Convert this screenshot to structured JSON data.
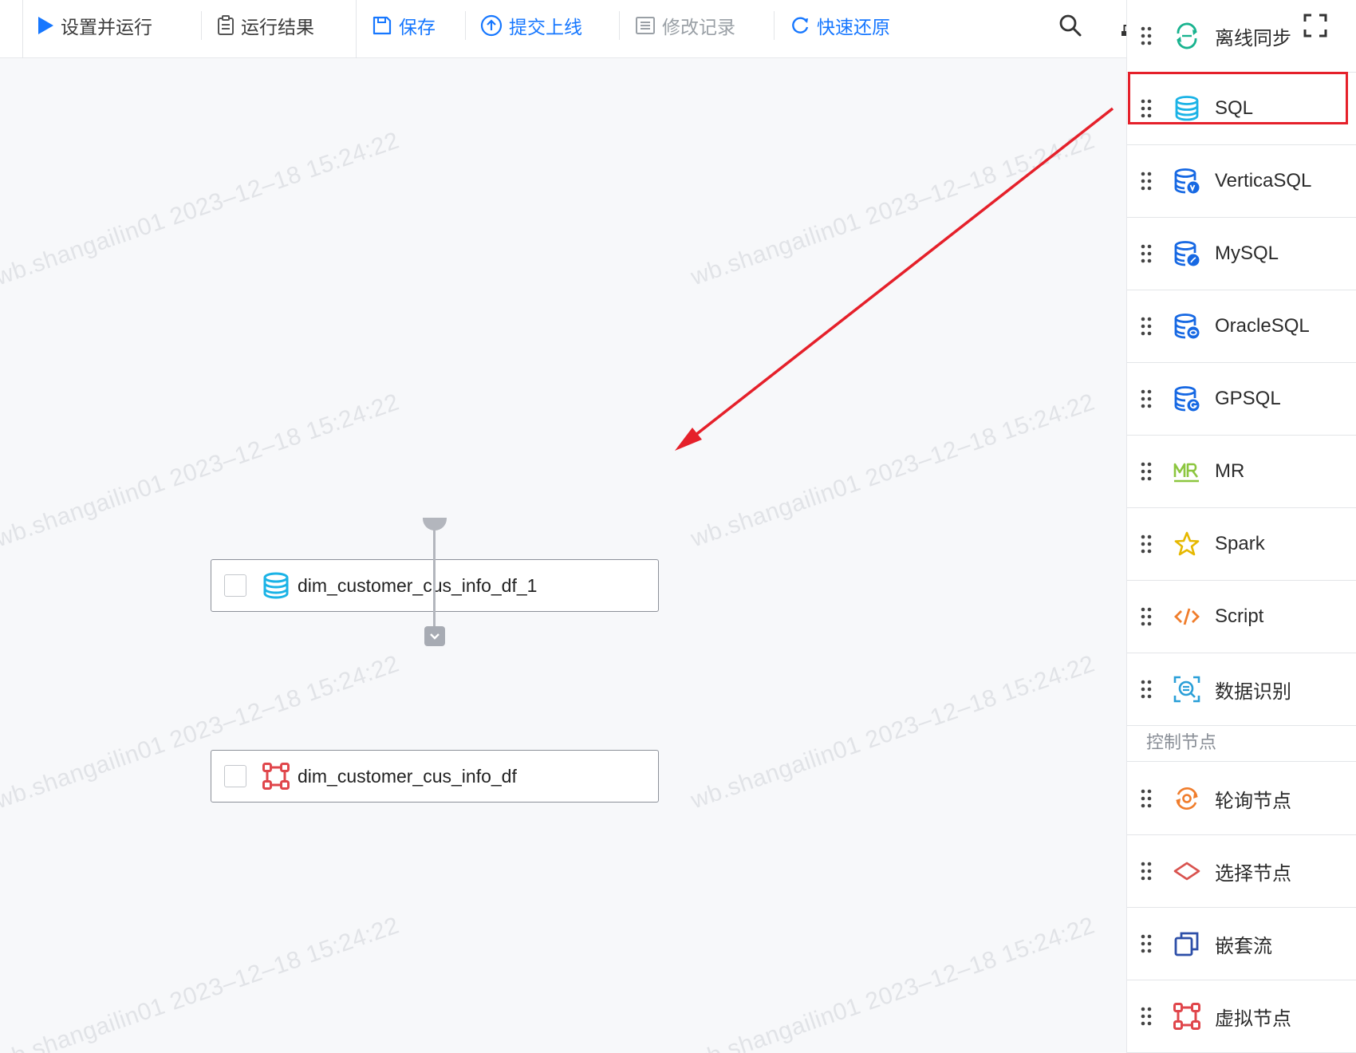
{
  "toolbar": {
    "run_label": "设置并运行",
    "results_label": "运行结果",
    "save_label": "保存",
    "submit_label": "提交上线",
    "history_label": "修改记录",
    "restore_label": "快速还原"
  },
  "canvas": {
    "watermark": "wb.shangailin01 2023–12–18 15:24:22",
    "nodes": [
      {
        "label": "dim_customer_cus_info_df_1",
        "icon": "sql-database-icon"
      },
      {
        "label": "dim_customer_cus_info_df",
        "icon": "virtual-node-icon"
      }
    ]
  },
  "panel": {
    "items": [
      {
        "label": "离线同步",
        "icon": "offline-sync-icon"
      },
      {
        "label": "SQL",
        "icon": "sql-icon"
      },
      {
        "label": "VerticaSQL",
        "icon": "vertica-sql-icon"
      },
      {
        "label": "MySQL",
        "icon": "mysql-icon"
      },
      {
        "label": "OracleSQL",
        "icon": "oracle-sql-icon"
      },
      {
        "label": "GPSQL",
        "icon": "gp-sql-icon"
      },
      {
        "label": "MR",
        "icon": "mr-icon"
      },
      {
        "label": "Spark",
        "icon": "star-icon"
      },
      {
        "label": "Script",
        "icon": "code-icon"
      },
      {
        "label": "数据识别",
        "icon": "data-recognition-icon"
      }
    ],
    "section_title": "控制节点",
    "control_items": [
      {
        "label": "轮询节点",
        "icon": "polling-icon"
      },
      {
        "label": "选择节点",
        "icon": "diamond-icon"
      },
      {
        "label": "嵌套流",
        "icon": "nested-flow-icon"
      },
      {
        "label": "虚拟节点",
        "icon": "virtual-node-icon"
      }
    ]
  },
  "colors": {
    "accent": "#1677ff",
    "highlight": "#e5202a",
    "sql_cyan": "#1bb3e6",
    "virtual_red": "#e0464b"
  }
}
